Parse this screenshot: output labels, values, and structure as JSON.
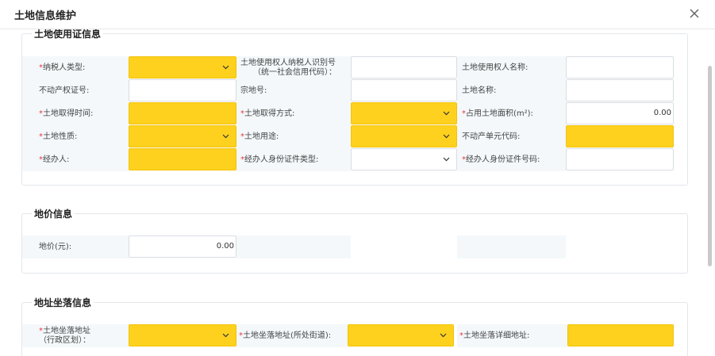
{
  "dialog": {
    "title": "土地信息维护",
    "close_icon": "close-icon"
  },
  "sections": {
    "cert": {
      "title": "土地使用证信息"
    },
    "price": {
      "title": "地价信息"
    },
    "addr": {
      "title": "地址坐落信息"
    }
  },
  "cert_fields": {
    "taxpayer_type_label": "纳税人类型:",
    "user_id_label_1": "土地使用权人纳税人识别号",
    "user_id_label_2": "（统一社会信用代码）：",
    "user_name_label": "土地使用权人名称:",
    "property_cert_label": "不动产权证号:",
    "parcel_no_label": "宗地号:",
    "land_name_label": "土地名称:",
    "acquire_time_label": "土地取得时间:",
    "acquire_method_label": "土地取得方式:",
    "area_label": "占用土地面积(m²):",
    "area_value": "0.00",
    "nature_label": "土地性质:",
    "usage_label": "土地用途:",
    "unit_code_label": "不动产单元代码:",
    "handler_label": "经办人:",
    "handler_id_type_label": "经办人身份证件类型:",
    "handler_id_no_label": "经办人身份证件号码:"
  },
  "price_fields": {
    "price_label": "地价(元):",
    "price_value": "0.00"
  },
  "addr_fields": {
    "district_label_1": "土地坐落地址",
    "district_label_2": "（行政区划）：",
    "street_label": "土地坐落地址(所处街道):",
    "detail_label": "土地坐落详细地址:"
  },
  "required_mark": "*",
  "colors": {
    "required_fill": "#fdd11e",
    "required_star": "#e4393c",
    "label_bg": "#f4f8fb"
  }
}
